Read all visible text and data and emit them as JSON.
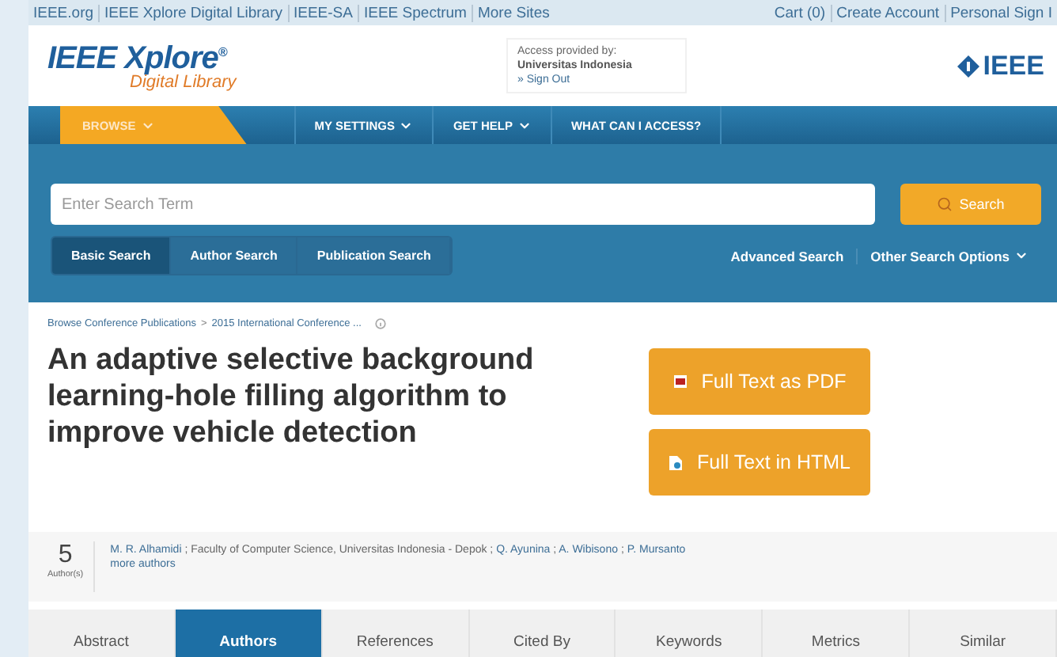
{
  "top_links": {
    "left": [
      "IEEE.org",
      "IEEE Xplore Digital Library",
      "IEEE-SA",
      "IEEE Spectrum",
      "More Sites"
    ],
    "right": [
      "Cart (0)",
      "Create Account",
      "Personal Sign I"
    ]
  },
  "header": {
    "logo_main": "IEEE Xplore",
    "logo_reg": "®",
    "logo_sub": "Digital Library",
    "access": {
      "label": "Access provided by:",
      "institution": "Universitas Indonesia",
      "sign_out": "» Sign Out"
    },
    "brand": "IEEE"
  },
  "nav": [
    {
      "label": "BROWSE",
      "selected": true,
      "caret": true
    },
    {
      "label": "MY SETTINGS",
      "selected": false,
      "caret": true
    },
    {
      "label": "GET HELP",
      "selected": false,
      "caret": true
    },
    {
      "label": "WHAT CAN I ACCESS?",
      "selected": false,
      "caret": false
    }
  ],
  "search": {
    "placeholder": "Enter Search Term",
    "button": "Search",
    "modes": [
      {
        "label": "Basic Search",
        "selected": true
      },
      {
        "label": "Author Search",
        "selected": false
      },
      {
        "label": "Publication Search",
        "selected": false
      }
    ],
    "advanced": "Advanced Search",
    "other": "Other Search Options"
  },
  "breadcrumb": {
    "separator": ">",
    "items": [
      "Browse Conference Publications",
      "2015 International Conference ..."
    ]
  },
  "title": "An adaptive selective background learning-hole filling algorithm to improve vehicle detection",
  "full_text": [
    {
      "label": "Full Text as PDF",
      "kind": "pdf"
    },
    {
      "label": "Full Text in HTML",
      "kind": "html"
    }
  ],
  "authors": {
    "count": "5",
    "count_label": "Author(s)",
    "segments": [
      {
        "text": "M. R. Alhamidi",
        "kind": "link"
      },
      {
        "text": " ; Faculty of Computer Science, Universitas Indonesia - Depok ; ",
        "kind": "plain"
      },
      {
        "text": "Q. Ayunina",
        "kind": "link"
      },
      {
        "text": " ; ",
        "kind": "plain"
      },
      {
        "text": "A. Wibisono",
        "kind": "link"
      },
      {
        "text": " ; ",
        "kind": "plain"
      },
      {
        "text": "P. Mursanto",
        "kind": "link"
      }
    ],
    "more": "more authors"
  },
  "tabs": [
    {
      "label": "Abstract",
      "selected": false
    },
    {
      "label": "Authors",
      "selected": true
    },
    {
      "label": "References",
      "selected": false
    },
    {
      "label": "Cited By",
      "selected": false
    },
    {
      "label": "Keywords",
      "selected": false
    },
    {
      "label": "Metrics",
      "selected": false
    },
    {
      "label": "Similar",
      "selected": false
    }
  ]
}
